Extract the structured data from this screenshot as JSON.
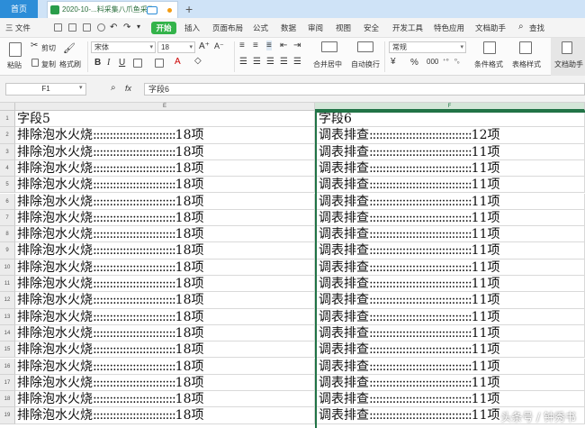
{
  "titlebar": {
    "home_tab": "首页",
    "doc_tab": "2020-10-...料采集八爪鱼采集",
    "add_tab": "+"
  },
  "menu": {
    "file": "三 文件",
    "start": "开始",
    "items": [
      "插入",
      "页面布局",
      "公式",
      "数据",
      "审阅",
      "视图",
      "安全",
      "开发工具",
      "特色应用",
      "文档助手"
    ],
    "search": "查找"
  },
  "ribbon": {
    "paste": "粘贴",
    "cut": "剪切",
    "copy": "复制",
    "format_painter": "格式刷",
    "font_name": "宋体",
    "font_size": "18",
    "bold": "B",
    "italic": "I",
    "underline": "U",
    "merge_center": "合并居中",
    "wrap": "自动换行",
    "number_format": "常规",
    "percent": "%",
    "conditional_format": "条件格式",
    "table_style": "表格样式",
    "doc_assistant": "文档助手"
  },
  "formula_bar": {
    "name_box": "F1",
    "fx": "fx",
    "content": "字段6"
  },
  "sheet": {
    "columns": [
      "E",
      "F"
    ],
    "rows": [
      "1",
      "2",
      "3",
      "4",
      "5",
      "6",
      "7",
      "8",
      "9",
      "10",
      "11",
      "12",
      "13",
      "14",
      "15",
      "16",
      "17",
      "18",
      "19"
    ],
    "header_e": "字段5",
    "header_f": "字段6",
    "e_value": "排除泡水火烧:::::::::::::::::::::::::18项",
    "f_first": "调表排查:::::::::::::::::::::::::::::::12项",
    "f_value": "调表排查:::::::::::::::::::::::::::::::11项"
  },
  "watermark": "头条号 / 钟秀书"
}
